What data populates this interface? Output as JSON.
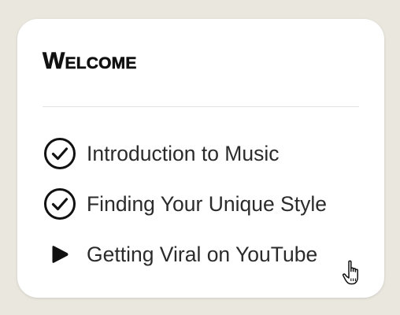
{
  "page": {
    "background_color": "#e9e7de",
    "card_color": "#ffffff"
  },
  "card": {
    "title": "Welcome"
  },
  "lessons": [
    {
      "label": "Introduction to Music",
      "status": "completed",
      "icon": "check-circle-icon"
    },
    {
      "label": "Finding Your Unique Style",
      "status": "completed",
      "icon": "check-circle-icon"
    },
    {
      "label": "Getting Viral on YouTube",
      "status": "current",
      "icon": "play-icon"
    }
  ],
  "pointer": {
    "icon": "hand-pointer-icon"
  }
}
